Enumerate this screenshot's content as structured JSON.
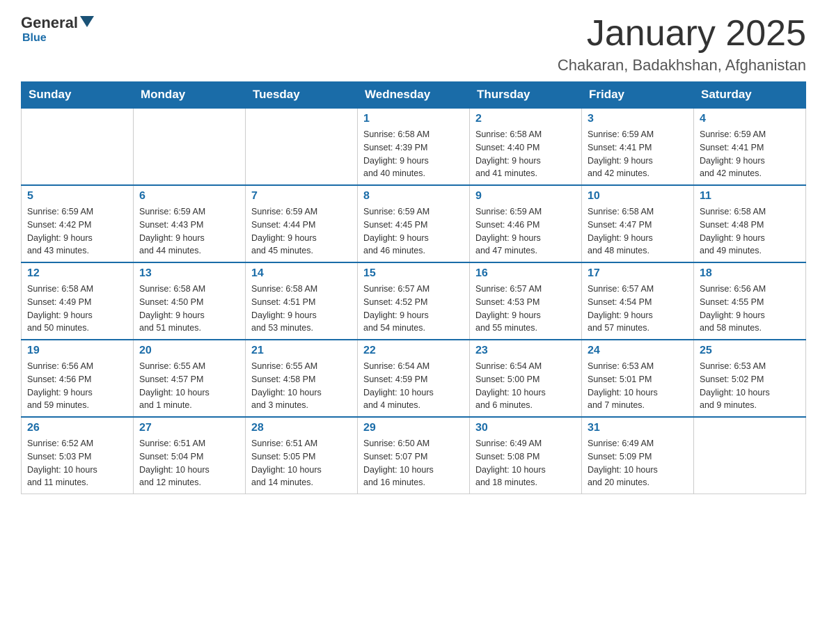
{
  "header": {
    "logo": {
      "general": "General",
      "blue": "Blue"
    },
    "title": "January 2025",
    "subtitle": "Chakaran, Badakhshan, Afghanistan"
  },
  "calendar": {
    "days_of_week": [
      "Sunday",
      "Monday",
      "Tuesday",
      "Wednesday",
      "Thursday",
      "Friday",
      "Saturday"
    ],
    "weeks": [
      [
        {
          "day": "",
          "info": ""
        },
        {
          "day": "",
          "info": ""
        },
        {
          "day": "",
          "info": ""
        },
        {
          "day": "1",
          "info": "Sunrise: 6:58 AM\nSunset: 4:39 PM\nDaylight: 9 hours\nand 40 minutes."
        },
        {
          "day": "2",
          "info": "Sunrise: 6:58 AM\nSunset: 4:40 PM\nDaylight: 9 hours\nand 41 minutes."
        },
        {
          "day": "3",
          "info": "Sunrise: 6:59 AM\nSunset: 4:41 PM\nDaylight: 9 hours\nand 42 minutes."
        },
        {
          "day": "4",
          "info": "Sunrise: 6:59 AM\nSunset: 4:41 PM\nDaylight: 9 hours\nand 42 minutes."
        }
      ],
      [
        {
          "day": "5",
          "info": "Sunrise: 6:59 AM\nSunset: 4:42 PM\nDaylight: 9 hours\nand 43 minutes."
        },
        {
          "day": "6",
          "info": "Sunrise: 6:59 AM\nSunset: 4:43 PM\nDaylight: 9 hours\nand 44 minutes."
        },
        {
          "day": "7",
          "info": "Sunrise: 6:59 AM\nSunset: 4:44 PM\nDaylight: 9 hours\nand 45 minutes."
        },
        {
          "day": "8",
          "info": "Sunrise: 6:59 AM\nSunset: 4:45 PM\nDaylight: 9 hours\nand 46 minutes."
        },
        {
          "day": "9",
          "info": "Sunrise: 6:59 AM\nSunset: 4:46 PM\nDaylight: 9 hours\nand 47 minutes."
        },
        {
          "day": "10",
          "info": "Sunrise: 6:58 AM\nSunset: 4:47 PM\nDaylight: 9 hours\nand 48 minutes."
        },
        {
          "day": "11",
          "info": "Sunrise: 6:58 AM\nSunset: 4:48 PM\nDaylight: 9 hours\nand 49 minutes."
        }
      ],
      [
        {
          "day": "12",
          "info": "Sunrise: 6:58 AM\nSunset: 4:49 PM\nDaylight: 9 hours\nand 50 minutes."
        },
        {
          "day": "13",
          "info": "Sunrise: 6:58 AM\nSunset: 4:50 PM\nDaylight: 9 hours\nand 51 minutes."
        },
        {
          "day": "14",
          "info": "Sunrise: 6:58 AM\nSunset: 4:51 PM\nDaylight: 9 hours\nand 53 minutes."
        },
        {
          "day": "15",
          "info": "Sunrise: 6:57 AM\nSunset: 4:52 PM\nDaylight: 9 hours\nand 54 minutes."
        },
        {
          "day": "16",
          "info": "Sunrise: 6:57 AM\nSunset: 4:53 PM\nDaylight: 9 hours\nand 55 minutes."
        },
        {
          "day": "17",
          "info": "Sunrise: 6:57 AM\nSunset: 4:54 PM\nDaylight: 9 hours\nand 57 minutes."
        },
        {
          "day": "18",
          "info": "Sunrise: 6:56 AM\nSunset: 4:55 PM\nDaylight: 9 hours\nand 58 minutes."
        }
      ],
      [
        {
          "day": "19",
          "info": "Sunrise: 6:56 AM\nSunset: 4:56 PM\nDaylight: 9 hours\nand 59 minutes."
        },
        {
          "day": "20",
          "info": "Sunrise: 6:55 AM\nSunset: 4:57 PM\nDaylight: 10 hours\nand 1 minute."
        },
        {
          "day": "21",
          "info": "Sunrise: 6:55 AM\nSunset: 4:58 PM\nDaylight: 10 hours\nand 3 minutes."
        },
        {
          "day": "22",
          "info": "Sunrise: 6:54 AM\nSunset: 4:59 PM\nDaylight: 10 hours\nand 4 minutes."
        },
        {
          "day": "23",
          "info": "Sunrise: 6:54 AM\nSunset: 5:00 PM\nDaylight: 10 hours\nand 6 minutes."
        },
        {
          "day": "24",
          "info": "Sunrise: 6:53 AM\nSunset: 5:01 PM\nDaylight: 10 hours\nand 7 minutes."
        },
        {
          "day": "25",
          "info": "Sunrise: 6:53 AM\nSunset: 5:02 PM\nDaylight: 10 hours\nand 9 minutes."
        }
      ],
      [
        {
          "day": "26",
          "info": "Sunrise: 6:52 AM\nSunset: 5:03 PM\nDaylight: 10 hours\nand 11 minutes."
        },
        {
          "day": "27",
          "info": "Sunrise: 6:51 AM\nSunset: 5:04 PM\nDaylight: 10 hours\nand 12 minutes."
        },
        {
          "day": "28",
          "info": "Sunrise: 6:51 AM\nSunset: 5:05 PM\nDaylight: 10 hours\nand 14 minutes."
        },
        {
          "day": "29",
          "info": "Sunrise: 6:50 AM\nSunset: 5:07 PM\nDaylight: 10 hours\nand 16 minutes."
        },
        {
          "day": "30",
          "info": "Sunrise: 6:49 AM\nSunset: 5:08 PM\nDaylight: 10 hours\nand 18 minutes."
        },
        {
          "day": "31",
          "info": "Sunrise: 6:49 AM\nSunset: 5:09 PM\nDaylight: 10 hours\nand 20 minutes."
        },
        {
          "day": "",
          "info": ""
        }
      ]
    ]
  }
}
